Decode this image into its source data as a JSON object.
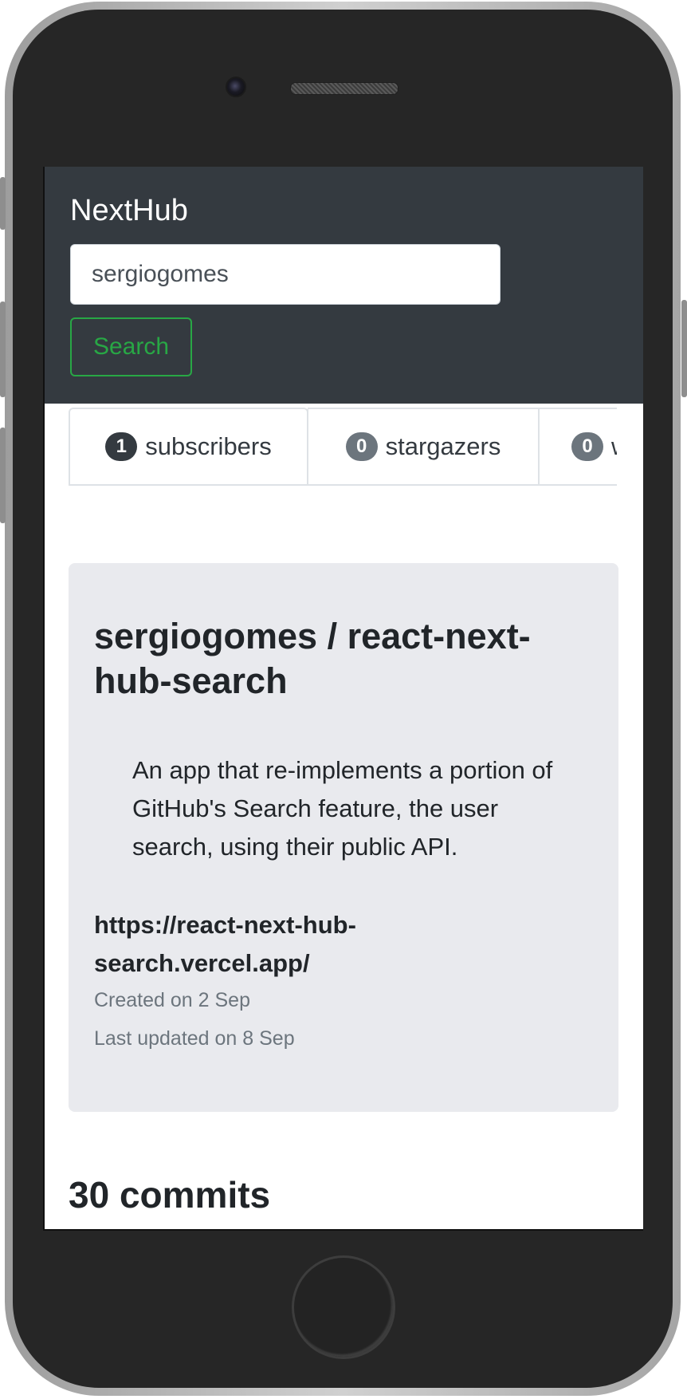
{
  "navbar": {
    "brand": "NextHub",
    "search_value": "sergiogomes",
    "search_button": "Search"
  },
  "tabs": [
    {
      "count": "1",
      "label": "subscribers"
    },
    {
      "count": "0",
      "label": "stargazers"
    },
    {
      "count": "0",
      "label": "w"
    }
  ],
  "repo": {
    "title": "sergiogomes / react-next-hub-search",
    "description": "An app that re-implements a portion of GitHub's Search feature, the user search, using their public API.",
    "link": "https://react-next-hub-search.vercel.app/",
    "created": "Created on 2 Sep",
    "updated": "Last updated on 8 Sep"
  },
  "commits": {
    "count": "30",
    "label": "commits"
  },
  "colors": {
    "navbar_bg": "#343a40",
    "accent_green": "#28a745",
    "card_bg": "#e9eaee"
  }
}
